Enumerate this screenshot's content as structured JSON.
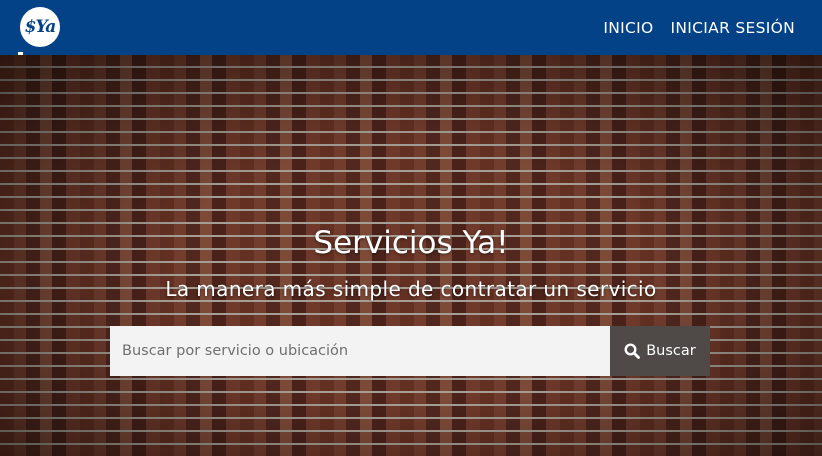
{
  "brand": {
    "logo_text": "$Ya",
    "colors": {
      "navbar": "#034287",
      "button": "#4f4a48",
      "input_bg": "#f3f3f3"
    }
  },
  "nav": {
    "links": [
      {
        "label": "INICIO"
      },
      {
        "label": "INICIAR SESIÓN"
      }
    ]
  },
  "hero": {
    "title": "Servicios Ya!",
    "subtitle": "La manera más simple de contratar un servicio",
    "background": "brick-wall"
  },
  "search": {
    "placeholder": "Buscar por servicio o ubicación",
    "value": "",
    "button_label": "Buscar",
    "button_icon": "search-icon"
  }
}
